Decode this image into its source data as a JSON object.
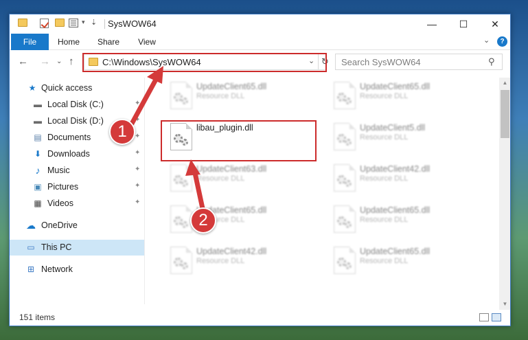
{
  "window": {
    "title": "SysWOW64"
  },
  "title_controls": {
    "minimize": "—",
    "maximize": "☐",
    "close": "✕"
  },
  "ribbon": {
    "tabs": [
      "File",
      "Home",
      "Share",
      "View"
    ],
    "expand_glyph": "⌄",
    "help_glyph": "?"
  },
  "navigation": {
    "back": "←",
    "forward": "→",
    "recent": "⌄",
    "up": "↑"
  },
  "address": {
    "path": "C:\\Windows\\SysWOW64",
    "dropdown": "⌄",
    "refresh": "↻"
  },
  "search": {
    "placeholder": "Search SysWOW64",
    "icon_glyph": "⚲"
  },
  "sidebar": {
    "items": [
      {
        "label": "Quick access",
        "icon": "star-icon",
        "glyph": "★"
      },
      {
        "label": "Local Disk (C:)",
        "icon": "drive-icon",
        "glyph": "▬"
      },
      {
        "label": "Local Disk (D:)",
        "icon": "drive-icon",
        "glyph": "▬"
      },
      {
        "label": "Documents",
        "icon": "document-icon",
        "glyph": "▤"
      },
      {
        "label": "Downloads",
        "icon": "download-icon",
        "glyph": "⬇"
      },
      {
        "label": "Music",
        "icon": "music-icon",
        "glyph": "♪"
      },
      {
        "label": "Pictures",
        "icon": "pictures-icon",
        "glyph": "▣"
      },
      {
        "label": "Videos",
        "icon": "video-icon",
        "glyph": "▦"
      },
      {
        "label": "OneDrive",
        "icon": "cloud-icon",
        "glyph": "☁"
      },
      {
        "label": "This PC",
        "icon": "computer-icon",
        "glyph": "▭"
      },
      {
        "label": "Network",
        "icon": "network-icon",
        "glyph": "⊞"
      }
    ],
    "pin_glyph": "📌"
  },
  "files": [
    {
      "name": "UpdateClient65.dll",
      "type": "Resource DLL"
    },
    {
      "name": "UpdateClient65.dll",
      "type": "Resource DLL"
    },
    {
      "name": "libau_plugin.dll",
      "type": ""
    },
    {
      "name": "UpdateClient5.dll",
      "type": "Resource DLL"
    },
    {
      "name": "UpdateClient63.dll",
      "type": "Resource DLL"
    },
    {
      "name": "UpdateClient42.dll",
      "type": "Resource DLL"
    },
    {
      "name": "UpdateClient65.dll",
      "type": "Resource DLL"
    },
    {
      "name": "UpdateClient65.dll",
      "type": "Resource DLL"
    },
    {
      "name": "UpdateClient42.dll",
      "type": "Resource DLL"
    },
    {
      "name": "UpdateClient65.dll",
      "type": "Resource DLL"
    }
  ],
  "scroll": {
    "up": "▲",
    "down": "▼"
  },
  "status": {
    "item_count": "151 items"
  },
  "callouts": [
    "1",
    "2"
  ],
  "colors": {
    "accent": "#1979ca",
    "highlight": "#cc2b2b",
    "selection": "#cde6f7"
  }
}
